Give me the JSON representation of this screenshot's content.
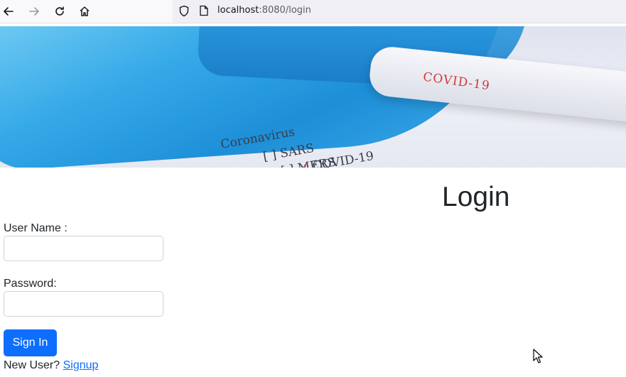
{
  "browser": {
    "url_host": "localhost",
    "url_rest": ":8080/login",
    "icons": [
      "back-arrow-icon",
      "forward-arrow-icon",
      "reload-icon",
      "home-icon",
      "shield-icon",
      "page-icon"
    ]
  },
  "banner": {
    "tube_label": "COVID-19",
    "doc_lines": [
      "Coronavirus",
      "[ ] SARS",
      "[ ] MERS",
      "COVID-19"
    ]
  },
  "login": {
    "title": "Login",
    "username_label": "User Name :",
    "username_value": "",
    "password_label": "Password:",
    "password_value": "",
    "submit_label": "Sign In",
    "new_user_text": "New User?",
    "signup_link": "Signup"
  },
  "colors": {
    "primary": "#0d6efd",
    "text": "#212529"
  }
}
